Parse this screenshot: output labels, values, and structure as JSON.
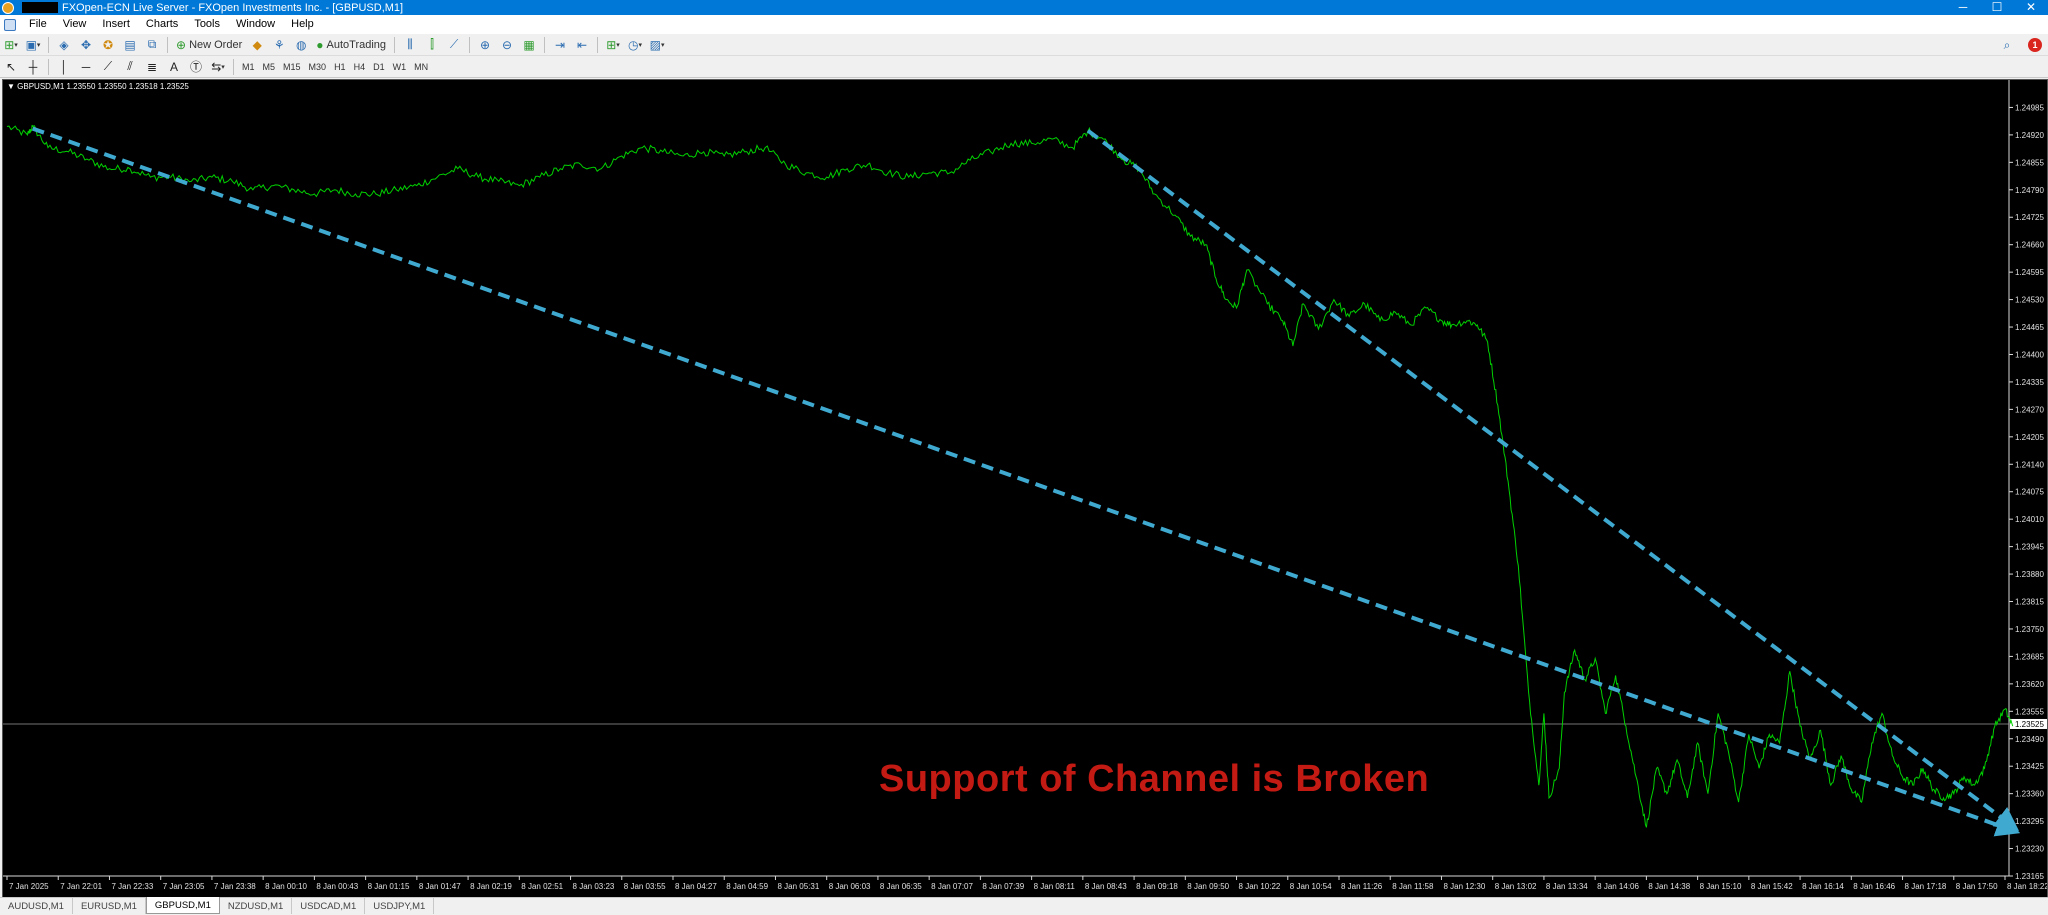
{
  "window": {
    "title": "FXOpen-ECN Live Server - FXOpen Investments Inc. - [GBPUSD,M1]",
    "controls": [
      "─",
      "☐",
      "✕"
    ]
  },
  "menu": [
    "File",
    "View",
    "Insert",
    "Charts",
    "Tools",
    "Window",
    "Help"
  ],
  "toolbar": {
    "new_order_label": "New Order",
    "autotrading_label": "AutoTrading",
    "notification_count": "1"
  },
  "timeframes": [
    "M1",
    "M5",
    "M15",
    "M30",
    "H1",
    "H4",
    "D1",
    "W1",
    "MN"
  ],
  "chart": {
    "header": "▼ GBPUSD,M1  1.23550 1.23550 1.23518 1.23525",
    "current_price": "1.23525",
    "annotation": "Support of Channel is Broken",
    "annotation_color": "#c41a14",
    "background": "#000000",
    "price_line_color": "#00d000",
    "trendline_color": "#3fa9d0"
  },
  "chart_data": {
    "type": "line",
    "symbol": "GBPUSD",
    "timeframe": "M1",
    "ylim": [
      1.23165,
      1.2505
    ],
    "y_ticks": [
      "1.24985",
      "1.24920",
      "1.24855",
      "1.24790",
      "1.24725",
      "1.24660",
      "1.24595",
      "1.24530",
      "1.24465",
      "1.24400",
      "1.24335",
      "1.24270",
      "1.24205",
      "1.24140",
      "1.24075",
      "1.24010",
      "1.23945",
      "1.23880",
      "1.23815",
      "1.23750",
      "1.23685",
      "1.23620",
      "1.23555",
      "1.23490",
      "1.23425",
      "1.23360",
      "1.23295",
      "1.23230",
      "1.23165"
    ],
    "x_ticks": [
      "7 Jan 2025",
      "7 Jan 22:01",
      "7 Jan 22:33",
      "7 Jan 23:05",
      "7 Jan 23:38",
      "8 Jan 00:10",
      "8 Jan 00:43",
      "8 Jan 01:15",
      "8 Jan 01:47",
      "8 Jan 02:19",
      "8 Jan 02:51",
      "8 Jan 03:23",
      "8 Jan 03:55",
      "8 Jan 04:27",
      "8 Jan 04:59",
      "8 Jan 05:31",
      "8 Jan 06:03",
      "8 Jan 06:35",
      "8 Jan 07:07",
      "8 Jan 07:39",
      "8 Jan 08:11",
      "8 Jan 08:43",
      "8 Jan 09:18",
      "8 Jan 09:50",
      "8 Jan 10:22",
      "8 Jan 10:54",
      "8 Jan 11:26",
      "8 Jan 11:58",
      "8 Jan 12:30",
      "8 Jan 13:02",
      "8 Jan 13:34",
      "8 Jan 14:06",
      "8 Jan 14:38",
      "8 Jan 15:10",
      "8 Jan 15:42",
      "8 Jan 16:14",
      "8 Jan 16:46",
      "8 Jan 17:18",
      "8 Jan 17:50",
      "8 Jan 18:22"
    ],
    "x_tick_index": [
      0,
      1,
      2,
      3,
      4,
      5,
      6,
      7,
      8,
      9,
      10,
      11,
      12,
      13,
      14,
      15,
      16,
      17,
      18,
      19,
      20,
      21,
      22,
      23,
      24,
      25,
      26,
      27,
      28,
      29,
      30,
      31,
      32,
      33,
      34,
      35,
      36,
      37,
      38,
      39
    ],
    "series": [
      {
        "points": [
          [
            0,
            1.2494
          ],
          [
            0.4,
            1.2492
          ],
          [
            0.5,
            1.2494
          ],
          [
            0.8,
            1.2489
          ],
          [
            1.2,
            1.2488
          ],
          [
            1.6,
            1.2486
          ],
          [
            2.0,
            1.2484
          ],
          [
            2.4,
            1.2484
          ],
          [
            2.8,
            1.2482
          ],
          [
            3.2,
            1.2482
          ],
          [
            3.6,
            1.2481
          ],
          [
            4.0,
            1.2482
          ],
          [
            4.4,
            1.2481
          ],
          [
            4.8,
            1.2479
          ],
          [
            5.2,
            1.248
          ],
          [
            5.6,
            1.2479
          ],
          [
            6.0,
            1.2478
          ],
          [
            6.4,
            1.2479
          ],
          [
            6.8,
            1.2478
          ],
          [
            7.2,
            1.2478
          ],
          [
            7.6,
            1.2479
          ],
          [
            8.0,
            1.248
          ],
          [
            8.4,
            1.2482
          ],
          [
            8.8,
            1.2484
          ],
          [
            9.2,
            1.2482
          ],
          [
            9.6,
            1.2481
          ],
          [
            10.0,
            1.248
          ],
          [
            10.4,
            1.2482
          ],
          [
            10.8,
            1.2484
          ],
          [
            11.2,
            1.2485
          ],
          [
            11.6,
            1.2484
          ],
          [
            12.0,
            1.2487
          ],
          [
            12.4,
            1.2489
          ],
          [
            12.8,
            1.2488
          ],
          [
            13.2,
            1.2487
          ],
          [
            13.6,
            1.2488
          ],
          [
            14.0,
            1.2487
          ],
          [
            14.4,
            1.2488
          ],
          [
            14.8,
            1.2489
          ],
          [
            15.2,
            1.2485
          ],
          [
            15.6,
            1.2483
          ],
          [
            16.0,
            1.2482
          ],
          [
            16.4,
            1.2484
          ],
          [
            16.8,
            1.2485
          ],
          [
            17.2,
            1.2483
          ],
          [
            17.6,
            1.2482
          ],
          [
            18.0,
            1.2483
          ],
          [
            18.4,
            1.2483
          ],
          [
            18.8,
            1.2486
          ],
          [
            19.2,
            1.2488
          ],
          [
            19.6,
            1.249
          ],
          [
            20.0,
            1.249
          ],
          [
            20.4,
            1.2491
          ],
          [
            20.8,
            1.2489
          ],
          [
            21.1,
            1.2493
          ],
          [
            21.4,
            1.2491
          ],
          [
            21.8,
            1.2486
          ],
          [
            22.1,
            1.2484
          ],
          [
            22.4,
            1.2478
          ],
          [
            22.8,
            1.2473
          ],
          [
            23.1,
            1.2468
          ],
          [
            23.4,
            1.2466
          ],
          [
            23.6,
            1.2458
          ],
          [
            23.8,
            1.2453
          ],
          [
            24.0,
            1.2451
          ],
          [
            24.2,
            1.246
          ],
          [
            24.6,
            1.2452
          ],
          [
            24.9,
            1.2448
          ],
          [
            25.1,
            1.2442
          ],
          [
            25.3,
            1.2452
          ],
          [
            25.6,
            1.2446
          ],
          [
            25.9,
            1.2453
          ],
          [
            26.2,
            1.2449
          ],
          [
            26.5,
            1.2452
          ],
          [
            26.8,
            1.2448
          ],
          [
            27.1,
            1.245
          ],
          [
            27.4,
            1.2447
          ],
          [
            27.7,
            1.2451
          ],
          [
            28.0,
            1.2448
          ],
          [
            28.2,
            1.2447
          ],
          [
            28.5,
            1.2448
          ],
          [
            28.7,
            1.2447
          ],
          [
            28.9,
            1.2443
          ],
          [
            29.1,
            1.2428
          ],
          [
            29.3,
            1.241
          ],
          [
            29.5,
            1.239
          ],
          [
            29.7,
            1.236
          ],
          [
            29.9,
            1.2338
          ],
          [
            30.0,
            1.2355
          ],
          [
            30.1,
            1.2335
          ],
          [
            30.3,
            1.2342
          ],
          [
            30.4,
            1.236
          ],
          [
            30.6,
            1.237
          ],
          [
            30.8,
            1.2363
          ],
          [
            31.0,
            1.2368
          ],
          [
            31.2,
            1.2355
          ],
          [
            31.4,
            1.2364
          ],
          [
            31.6,
            1.2352
          ],
          [
            31.8,
            1.234
          ],
          [
            32.0,
            1.2328
          ],
          [
            32.2,
            1.2342
          ],
          [
            32.4,
            1.2336
          ],
          [
            32.6,
            1.2344
          ],
          [
            32.8,
            1.2335
          ],
          [
            33.0,
            1.2348
          ],
          [
            33.2,
            1.2336
          ],
          [
            33.4,
            1.2355
          ],
          [
            33.6,
            1.2346
          ],
          [
            33.8,
            1.2334
          ],
          [
            34.0,
            1.235
          ],
          [
            34.2,
            1.2342
          ],
          [
            34.4,
            1.235
          ],
          [
            34.6,
            1.2348
          ],
          [
            34.8,
            1.2365
          ],
          [
            35.0,
            1.2352
          ],
          [
            35.2,
            1.2344
          ],
          [
            35.4,
            1.2351
          ],
          [
            35.6,
            1.2338
          ],
          [
            35.8,
            1.2345
          ],
          [
            36.0,
            1.2337
          ],
          [
            36.2,
            1.2334
          ],
          [
            36.4,
            1.2348
          ],
          [
            36.6,
            1.2355
          ],
          [
            36.8,
            1.2345
          ],
          [
            37.0,
            1.234
          ],
          [
            37.2,
            1.2338
          ],
          [
            37.4,
            1.2342
          ],
          [
            37.6,
            1.2337
          ],
          [
            37.8,
            1.2335
          ],
          [
            38.0,
            1.2336
          ],
          [
            38.2,
            1.234
          ],
          [
            38.4,
            1.2338
          ],
          [
            38.6,
            1.2342
          ],
          [
            38.8,
            1.2352
          ],
          [
            39.0,
            1.2356
          ],
          [
            39.15,
            1.2352
          ]
        ]
      }
    ],
    "trendlines": [
      {
        "from": [
          0.5,
          1.24935
        ],
        "to": [
          39.15,
          1.23273
        ],
        "style": "dashed",
        "arrow": true
      },
      {
        "from": [
          21.1,
          1.2493
        ],
        "to": [
          39.15,
          1.23283
        ],
        "style": "dashed",
        "arrow": true
      }
    ],
    "current_price_line": 1.23525,
    "grid": false,
    "legend": "none"
  },
  "tabs": [
    "AUDUSD,M1",
    "EURUSD,M1",
    "GBPUSD,M1",
    "NZDUSD,M1",
    "USDCAD,M1",
    "USDJPY,M1"
  ],
  "active_tab": "GBPUSD,M1"
}
